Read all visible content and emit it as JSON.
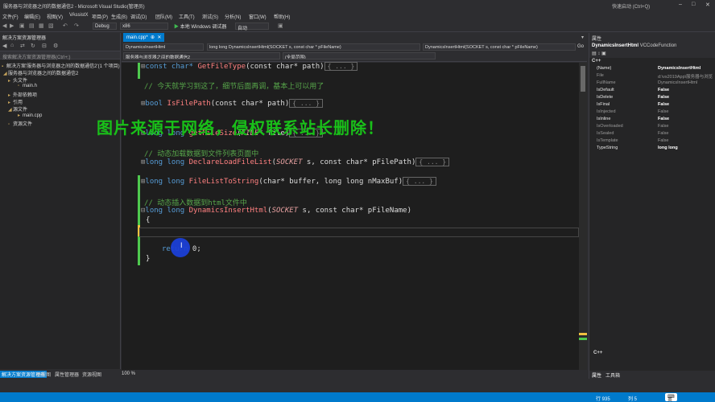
{
  "window": {
    "title": "服务器与浏览器之间的数据通信2 - Microsoft Visual Studio(管理员)",
    "quick_launch": "快速启动 (Ctrl+Q)",
    "controls": [
      "–",
      "□",
      "✕"
    ]
  },
  "menu": [
    "文件(F)",
    "编辑(E)",
    "视图(V)",
    "VAssistX",
    "项目(P)",
    "生成(B)",
    "调试(D)",
    "团队(M)",
    "工具(T)",
    "测试(S)",
    "分析(N)",
    "窗口(W)",
    "帮助(H)"
  ],
  "toolbar": {
    "config": "Debug",
    "platform": "x86",
    "run_label": "本地 Windows 调试器",
    "run_mode": "自动"
  },
  "solution_explorer": {
    "header": "解决方案资源管理器",
    "search_placeholder": "搜索解决方案资源管理器(Ctrl+;)",
    "items": [
      {
        "label": "解决方案'服务器与浏览器之间的数据通信2'(1 个项目)",
        "icon": "solution-icon"
      },
      {
        "label": "服务器与浏览器之间的数据通信2",
        "icon": "project-icon"
      },
      {
        "label": "头文件",
        "icon": "folder-icon"
      },
      {
        "label": "main.h",
        "icon": "header-file-icon"
      },
      {
        "label": "外部依赖项",
        "icon": "folder-icon"
      },
      {
        "label": "引用",
        "icon": "references-icon"
      },
      {
        "label": "源文件",
        "icon": "folder-icon"
      },
      {
        "label": "main.cpp",
        "icon": "cpp-file-icon"
      },
      {
        "label": "资源文件",
        "icon": "folder-icon"
      }
    ]
  },
  "bottom_tabs": [
    "解决方案资源管理器",
    "类视图",
    "属性管理器",
    "资源视图"
  ],
  "document": {
    "tab": "main.cpp*",
    "nav_project": "服务器与浏览器之间的数据通信2",
    "nav_scope": "(全局范围)",
    "nav_func_left": "DynamicsInsertHtml",
    "nav_func_sig": "long long DynamicsInsertHtml(SOCKET s, const char * pFileName)",
    "nav_func_right": "DynamicsInsertHtml(SOCKET s, const char * pFileName)",
    "zoom": "100 %"
  },
  "code": {
    "l1_kw": "const char*",
    "l1_fn": "GetFileType",
    "l1_args_a": "(const char* path)",
    "collapsed": "{ ... }",
    "comment1": "// 今天就学习到这了，细节后面再调，基本上可以用了",
    "l2_kw": "bool",
    "l2_fn": "IsFilePath",
    "l2_args": "(const char* path)",
    "l3_kw": "long long",
    "l3_fn": "getFileSize",
    "l3_ty": "FILE",
    "l3_args": "* file)",
    "comment2": "// 动态加载数据到文件列表页面中",
    "l4_kw": "long long",
    "l4_fn": "DeclareLoadFileList",
    "l4_ty": "SOCKET",
    "l4_args": " s, const char* pFilePath)",
    "l5_kw": "long long",
    "l5_fn": "FileListToString",
    "l5_args": "(char* buffer, long long nMaxBuf)",
    "comment3": "// 动态插入数据到html文件中",
    "l6_kw": "long long",
    "l6_fn": "DynamicsInsertHtml",
    "l6_ty": "SOCKET",
    "l6_args": " s, const char* pFileName)",
    "open_brace": "{",
    "ret_kw": "return",
    "ret_val": " 0;",
    "close_brace": "}"
  },
  "watermark": "图片来源于网络，侵权联系站长删除！",
  "properties": {
    "header": "属性",
    "object_name": "DynamicsInsertHtml",
    "object_type": "VCCodeFunction",
    "category": "C++",
    "rows": [
      {
        "k": "(Name)",
        "v": "DynamicsInsertHtml",
        "bold": true
      },
      {
        "k": "File",
        "v": "d:\\vs2019App\\服务器与浏览",
        "bold": false
      },
      {
        "k": "FullName",
        "v": "DynamicsInsertHtml",
        "bold": false
      },
      {
        "k": "IsDefault",
        "v": "False",
        "bold": true
      },
      {
        "k": "IsDelete",
        "v": "False",
        "bold": true
      },
      {
        "k": "IsFinal",
        "v": "False",
        "bold": true
      },
      {
        "k": "IsInjected",
        "v": "False",
        "bold": false
      },
      {
        "k": "IsInline",
        "v": "False",
        "bold": true
      },
      {
        "k": "IsOverloaded",
        "v": "False",
        "bold": false
      },
      {
        "k": "IsSealed",
        "v": "False",
        "bold": false
      },
      {
        "k": "IsTemplate",
        "v": "False",
        "bold": false
      },
      {
        "k": "TypeString",
        "v": "long long",
        "bold": true
      }
    ],
    "bottom_label": "C++",
    "tabs": [
      "属性",
      "工具箱"
    ]
  },
  "status": {
    "line": "行 935",
    "col": "列 5",
    "ime": "英"
  },
  "colors": {
    "accent": "#007acc",
    "keyword": "#569cd6",
    "function": "#ff8080",
    "comment": "#57a64a",
    "watermark": "#19c019",
    "changed_marker": "#f0c040",
    "saved_marker": "#4ec94e"
  }
}
